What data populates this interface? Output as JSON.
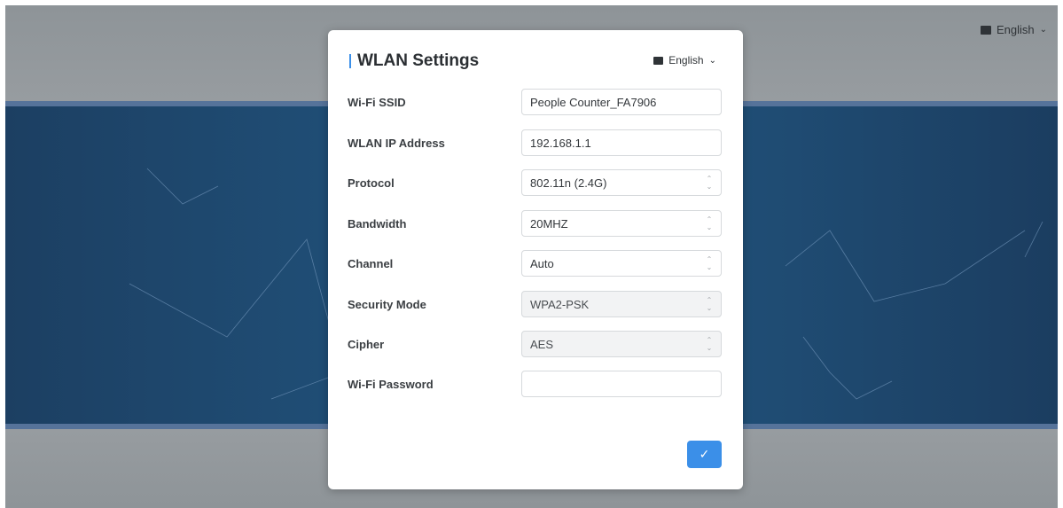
{
  "page": {
    "language": "English"
  },
  "modal": {
    "title": "WLAN Settings",
    "language": "English",
    "fields": [
      {
        "label": "Wi-Fi SSID",
        "value": "People Counter_FA7906",
        "type": "text"
      },
      {
        "label": "WLAN IP Address",
        "value": "192.168.1.1",
        "type": "text"
      },
      {
        "label": "Protocol",
        "value": "802.11n (2.4G)",
        "type": "select"
      },
      {
        "label": "Bandwidth",
        "value": "20MHZ",
        "type": "select"
      },
      {
        "label": "Channel",
        "value": "Auto",
        "type": "select"
      },
      {
        "label": "Security Mode",
        "value": "WPA2-PSK",
        "type": "select-disabled"
      },
      {
        "label": "Cipher",
        "value": "AES",
        "type": "select-disabled"
      },
      {
        "label": "Wi-Fi Password",
        "value": "",
        "type": "password"
      }
    ],
    "confirm_icon": "check-icon",
    "accent_color": "#3b8fe8"
  }
}
